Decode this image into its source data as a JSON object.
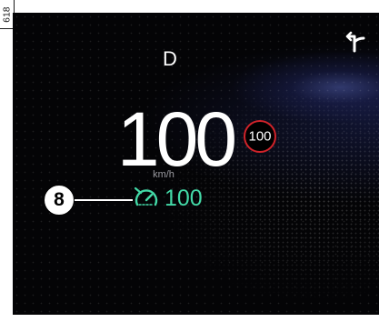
{
  "figure_tag": "618",
  "colors": {
    "background": "#040406",
    "speed_text": "#ffffff",
    "unit_text": "#9a9aa0",
    "speed_limit_ring": "#d0232a",
    "cruise_accent": "#43d9a7"
  },
  "cluster": {
    "gear": "D",
    "speed": "100",
    "unit": "km/h",
    "speed_limit": "100",
    "cruise_set_speed": "100",
    "navigation_icon": "turn-right-arrow-icon",
    "cruise_icon": "speedometer-limiter-icon"
  },
  "callout": {
    "number": "8"
  }
}
